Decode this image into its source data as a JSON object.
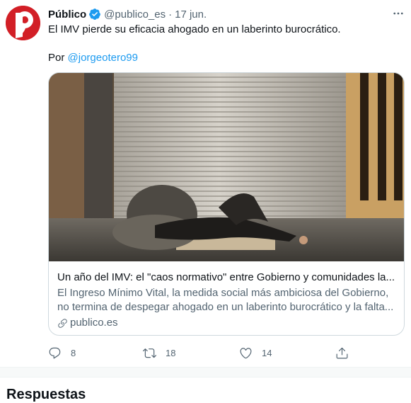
{
  "tweet": {
    "author_name": "Público",
    "handle": "@publico_es",
    "separator": "·",
    "date": "17 jun.",
    "text": "El IMV pierde su eficacia ahogado en un laberinto burocrático.",
    "byline_prefix": "Por ",
    "byline_mention": "@jorgeotero99",
    "avatar_logo_letter": "P",
    "avatar_color": "#d21f26",
    "verified_color": "#1d9bf0"
  },
  "card": {
    "title": "Un año del IMV: el \"caos normativo\" entre Gobierno y comunidades la...",
    "description_line1": "El Ingreso Mínimo Vital, la medida social más ambiciosa del Gobierno,",
    "description_line2": "no termina de despegar ahogado en un laberinto burocrático y la falta...",
    "domain": "publico.es",
    "link_icon": "link-icon"
  },
  "actions": {
    "reply_count": "8",
    "retweet_count": "18",
    "like_count": "14"
  },
  "section": {
    "title": "Respuestas"
  },
  "icons": [
    "more-icon",
    "verified-icon",
    "reply-icon",
    "retweet-icon",
    "like-icon",
    "share-icon",
    "link-icon"
  ]
}
